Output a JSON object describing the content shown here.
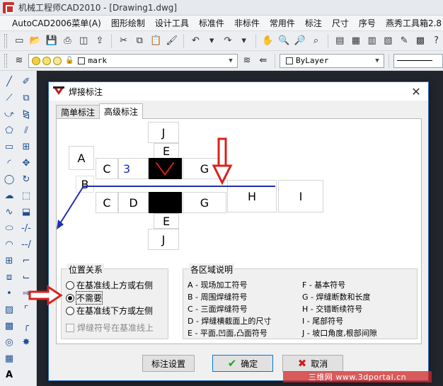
{
  "window": {
    "title": "机械工程师CAD2010 - [Drawing1.dwg]"
  },
  "menubar": {
    "items": [
      "AutoCAD2006菜单(A)",
      "图形绘制",
      "设计工具",
      "标准件",
      "非标件",
      "常用件",
      "标注",
      "尺寸",
      "序号",
      "燕秀工具箱2.8"
    ]
  },
  "layer_toolbar": {
    "layer_name": "mark",
    "color_value": "ByLayer"
  },
  "dialog": {
    "title": "焊接标注",
    "close_glyph": "✕",
    "tabs": [
      {
        "label": "简单标注",
        "active": false
      },
      {
        "label": "高级标注",
        "active": true
      }
    ],
    "diagram": {
      "top_j": "J",
      "top_e": "E",
      "a": "A",
      "c_upper": "C",
      "c_upper_value": "3",
      "g_upper": "G",
      "b": "B",
      "h": "H",
      "i": "I",
      "c_lower": "C",
      "d_lower": "D",
      "g_lower": "G",
      "bottom_e": "E",
      "bottom_j": "J"
    },
    "position_group": {
      "label": "位置关系",
      "options": [
        {
          "label": "在基准线上方或右侧",
          "selected": false
        },
        {
          "label": "不需要",
          "selected": true
        },
        {
          "label": "在基准线下方或左侧",
          "selected": false
        }
      ],
      "checkbox_label": "焊缝符号在基准线上"
    },
    "legend_group": {
      "label": "各区域说明",
      "left_items": [
        "A - 现场加工符号",
        "B - 周围焊缝符号",
        "C - 三面焊缝符号",
        "D - 焊缝横截面上的尺寸",
        "E - 平面,凹面,凸面符号"
      ],
      "right_items": [
        "F - 基本符号",
        "G - 焊缝断数和长度",
        "H - 交错断续符号",
        "I - 尾部符号",
        "J - 坡口角度,根部间隙"
      ]
    },
    "buttons": {
      "settings": "标注设置",
      "ok": "确定",
      "cancel": "取消"
    }
  },
  "watermark": {
    "text": "三维网 www.3dportal.cn"
  },
  "colors": {
    "annotation_red": "#d8231d",
    "reference_line_blue": "#1f2fb3",
    "value_blue": "#1a2bbf",
    "dialog_border": "#2d6fb8"
  }
}
